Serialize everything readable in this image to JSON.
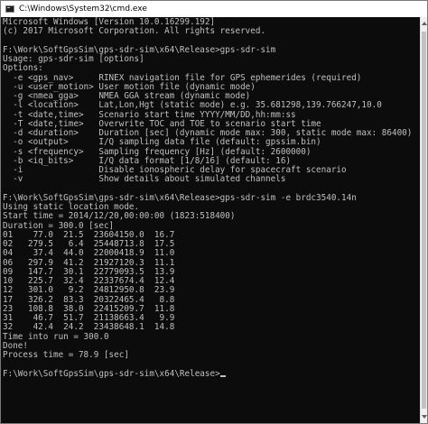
{
  "window": {
    "title": "C:\\Windows\\System32\\cmd.exe",
    "icon": "cmd-console-icon",
    "background_color": "#0c0c0c",
    "text_color": "#c0c0c0"
  },
  "console": {
    "lines": [
      "Microsoft Windows [Version 10.0.16299.192]",
      "(c) 2017 Microsoft Corporation. All rights reserved.",
      "",
      "F:\\Work\\SoftGpsSim\\gps-sdr-sim\\x64\\Release>gps-sdr-sim",
      "Usage: gps-sdr-sim [options]",
      "Options:",
      "  -e <gps_nav>     RINEX navigation file for GPS ephemerides (required)",
      "  -u <user_motion> User motion file (dynamic mode)",
      "  -g <nmea_gga>    NMEA GGA stream (dynamic mode)",
      "  -l <location>    Lat,Lon,Hgt (static mode) e.g. 35.681298,139.766247,10.0",
      "  -t <date,time>   Scenario start time YYYY/MM/DD,hh:mm:ss",
      "  -T <date,time>   Overwrite TOC and TOE to scenario start time",
      "  -d <duration>    Duration [sec] (dynamic mode max: 300, static mode max: 86400)",
      "  -o <output>      I/Q sampling data file (default: gpssim.bin)",
      "  -s <frequency>   Sampling frequency [Hz] (default: 2600000)",
      "  -b <iq_bits>     I/Q data format [1/8/16] (default: 16)",
      "  -i               Disable ionospheric delay for spacecraft scenario",
      "  -v               Show details about simulated channels",
      "",
      "F:\\Work\\SoftGpsSim\\gps-sdr-sim\\x64\\Release>gps-sdr-sim -e brdc3540.14n",
      "Using static location mode.",
      "Start time = 2014/12/20,00:00:00 (1823:518400)",
      "Duration = 300.0 [sec]",
      "01    77.0  21.5  23604150.0  16.7",
      "02   279.5   6.4  25448713.8  17.5",
      "04    37.4  44.0  22000418.9  11.0",
      "06   297.9  41.2  21927120.3  11.1",
      "09   147.7  30.1  22779093.5  13.9",
      "10   225.7  32.4  22337674.4  12.4",
      "12   301.0   9.2  24812950.8  23.9",
      "17   326.2  83.3  20322465.4   8.8",
      "23   108.8  38.0  22415209.7  11.8",
      "31    46.7  51.7  21138663.4   9.9",
      "32    42.4  24.2  23438648.1  14.8",
      "Time into run = 300.0",
      "Done!",
      "Process time = 78.9 [sec]",
      "",
      "F:\\Work\\SoftGpsSim\\gps-sdr-sim\\x64\\Release>"
    ]
  }
}
